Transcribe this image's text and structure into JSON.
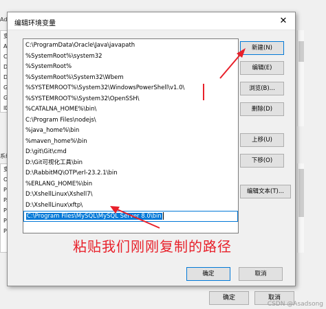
{
  "background_window": {
    "title_fragment": "Adm",
    "list1_items": [
      "变",
      "AP",
      "CL",
      "DA",
      "DA",
      "GA",
      "GO",
      "IDI"
    ],
    "section_fragment": "系统",
    "list2_items": [
      "变",
      "OS",
      "Pa",
      "PA",
      "PR",
      "PR",
      "PR"
    ],
    "ok_label": "确定",
    "cancel_label": "取消"
  },
  "dialog": {
    "title": "编辑环境变量",
    "close_glyph": "✕",
    "paths": [
      "C:\\ProgramData\\Oracle\\Java\\javapath",
      "%SystemRoot%\\system32",
      "%SystemRoot%",
      "%SystemRoot%\\System32\\Wbem",
      "%SYSTEMROOT%\\System32\\WindowsPowerShell\\v1.0\\",
      "%SYSTEMROOT%\\System32\\OpenSSH\\",
      "%CATALNA_HOME%\\bin\\",
      "C:\\Program Files\\nodejs\\",
      "%java_home%\\bin",
      "%maven_home%\\bin",
      "D:\\git\\Git\\cmd",
      "D:\\Git可视化工具\\bin",
      "D:\\RabbitMQ\\OTP\\erl-23.2.1\\bin",
      "%ERLANG_HOME%\\bin",
      "D:\\XshellLinux\\Xshell7\\",
      "D:\\XshellLinux\\xftp\\"
    ],
    "editing_path": "C:\\Program Files\\MySQL\\MySQL Server 8.0\\bin",
    "buttons": {
      "new": "新建(N)",
      "edit": "编辑(E)",
      "browse": "浏览(B)...",
      "delete": "删除(D)",
      "move_up": "上移(U)",
      "move_down": "下移(O)",
      "edit_text": "编辑文本(T)...",
      "ok": "确定",
      "cancel": "取消"
    }
  },
  "annotation": {
    "instruction": "粘贴我们刚刚复制的路径",
    "color": "#e8202a"
  },
  "watermark": "CSDN @Asadsong"
}
